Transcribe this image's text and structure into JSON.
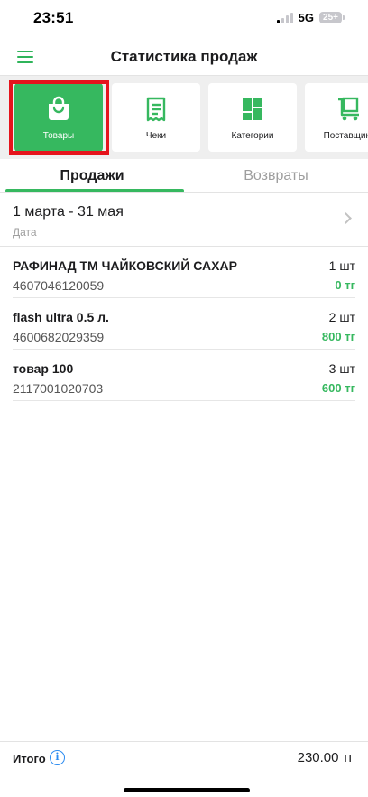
{
  "status_bar": {
    "time": "23:51",
    "network": "5G",
    "battery": "25+"
  },
  "header": {
    "title": "Статистика продаж",
    "menu_icon": "hamburger-menu-icon"
  },
  "tiles": [
    {
      "label": "Товары",
      "icon": "shopping-bag-icon",
      "active": true
    },
    {
      "label": "Чеки",
      "icon": "receipt-icon",
      "active": false
    },
    {
      "label": "Категории",
      "icon": "grid-icon",
      "active": false
    },
    {
      "label": "Поставщики",
      "icon": "cart-icon",
      "active": false
    }
  ],
  "tabs": {
    "sales": "Продажи",
    "returns": "Возвраты",
    "active": "sales"
  },
  "date_filter": {
    "value": "1 марта - 31 мая",
    "label": "Дата"
  },
  "items": [
    {
      "name": "РАФИНАД ТМ ЧАЙКОВСКИЙ САХАР",
      "code": "4607046120059",
      "qty": "1 шт",
      "sum": "0 тг"
    },
    {
      "name": "flash ultra 0.5 л.",
      "code": "4600682029359",
      "qty": "2 шт",
      "sum": "800 тг"
    },
    {
      "name": "товар 100",
      "code": "2117001020703",
      "qty": "3 шт",
      "sum": "600 тг"
    }
  ],
  "footer": {
    "total_label": "Итого",
    "total_value": "230.00 тг"
  },
  "colors": {
    "accent": "#36b85f",
    "highlight_frame": "#e5141c",
    "info": "#2d8cf0"
  }
}
